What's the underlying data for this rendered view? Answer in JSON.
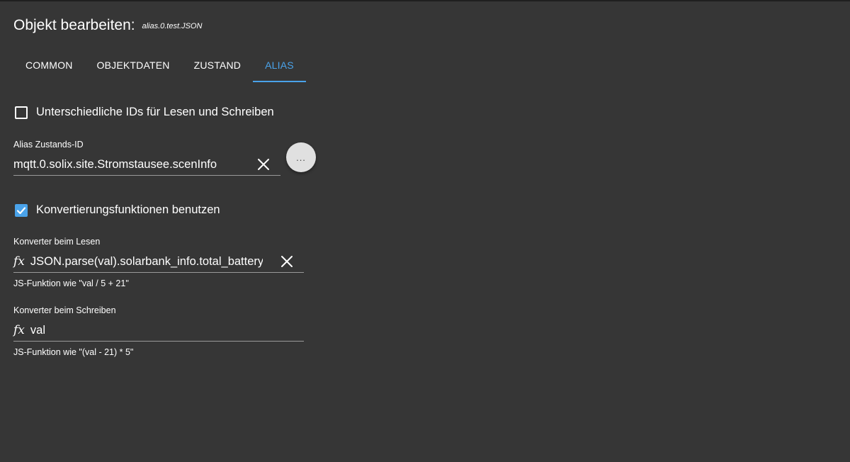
{
  "dialog": {
    "title": "Objekt bearbeiten:",
    "object_id": "alias.0.test.JSON"
  },
  "tabs": [
    {
      "label": "COMMON",
      "active": false
    },
    {
      "label": "OBJEKTDATEN",
      "active": false
    },
    {
      "label": "ZUSTAND",
      "active": false
    },
    {
      "label": "ALIAS",
      "active": true
    }
  ],
  "different_ids": {
    "label": "Unterschiedliche IDs für Lesen und Schreiben",
    "checked": false
  },
  "alias_state": {
    "label": "Alias Zustands-ID",
    "value": "mqtt.0.solix.site.Stromstausee.scenInfo",
    "select_button_label": "..."
  },
  "use_conversion": {
    "label": "Konvertierungsfunktionen benutzen",
    "checked": true
  },
  "read_converter": {
    "label": "Konverter beim Lesen",
    "fx_symbol": "fx",
    "value": "JSON.parse(val).solarbank_info.total_battery_power",
    "helper": "JS-Funktion wie \"val / 5 + 21\""
  },
  "write_converter": {
    "label": "Konverter beim Schreiben",
    "fx_symbol": "fx",
    "value": "val",
    "helper": "JS-Funktion wie \"(val - 21) * 5\""
  },
  "colors": {
    "background": "#363636",
    "accent": "#4aa3ea",
    "text": "#ffffff"
  }
}
